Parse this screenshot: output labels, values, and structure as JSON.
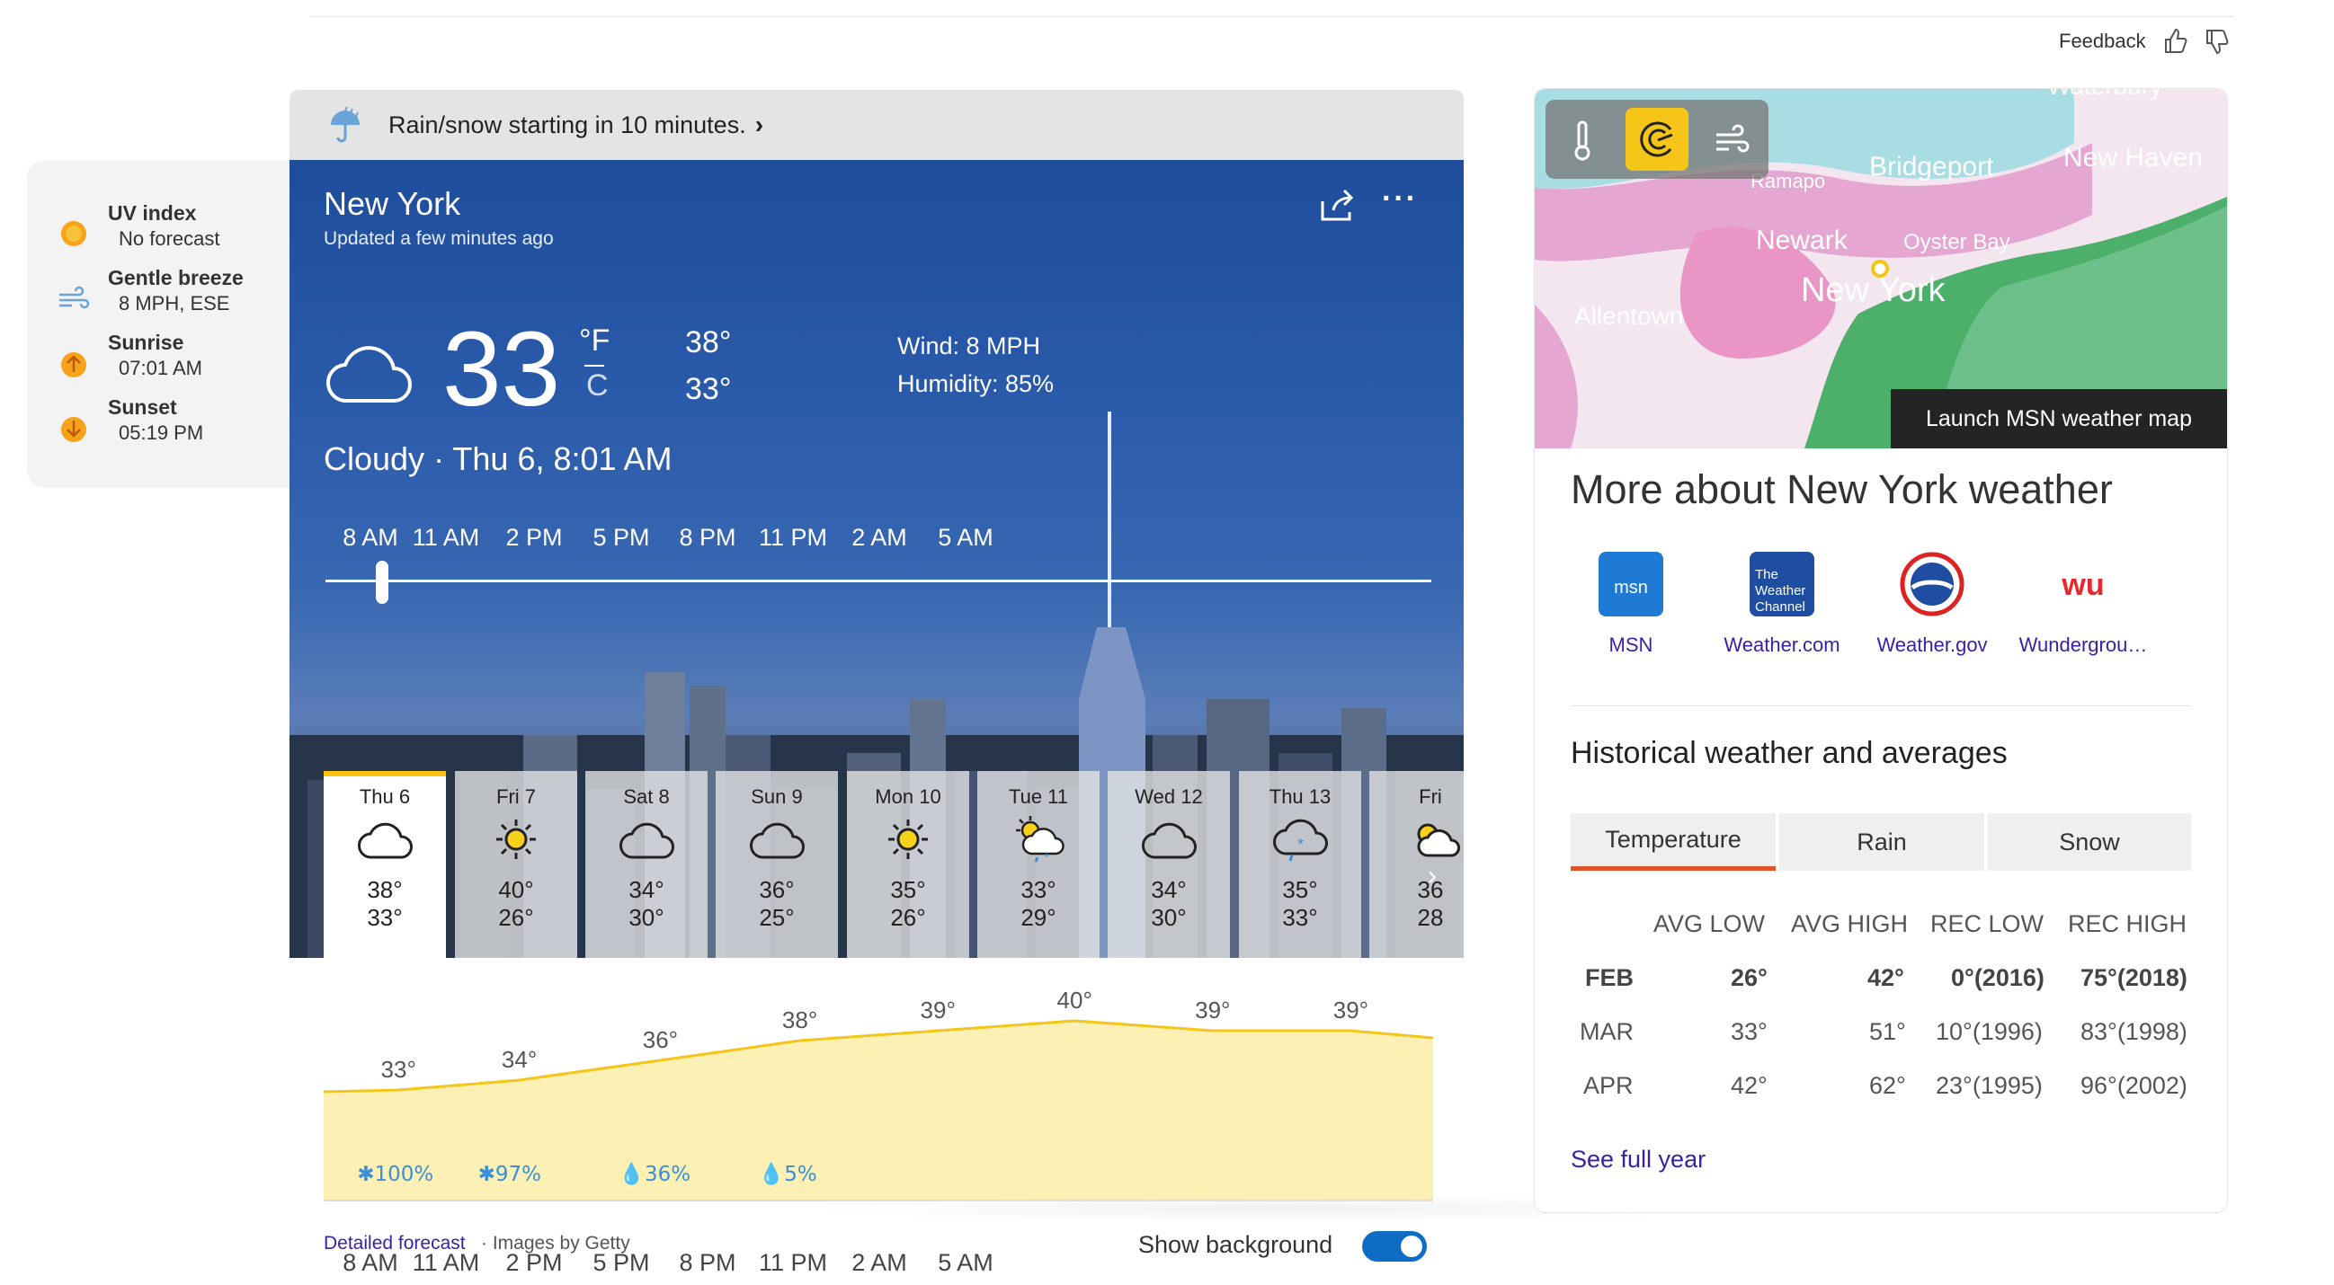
{
  "feedback": {
    "label": "Feedback"
  },
  "side": {
    "items": [
      {
        "title": "UV index",
        "value": "No forecast",
        "icon": "uv-sun-icon"
      },
      {
        "title": "Gentle breeze",
        "value": "8 MPH, ESE",
        "icon": "wind-icon"
      },
      {
        "title": "Sunrise",
        "value": "07:01 AM",
        "icon": "sunrise-icon"
      },
      {
        "title": "Sunset",
        "value": "05:19 PM",
        "icon": "sunset-icon"
      }
    ]
  },
  "alert": {
    "text": "Rain/snow starting in 10 minutes."
  },
  "current": {
    "city": "New York",
    "updated": "Updated a few minutes ago",
    "temp": "33",
    "unit_f": "°F",
    "unit_c": "C",
    "high": "38°",
    "low": "33°",
    "wind": "Wind: 8 MPH",
    "humidity": "Humidity: 85%",
    "condition": "Cloudy · Thu 6, 8:01 AM"
  },
  "hours": [
    "8 AM",
    "11 AM",
    "2 PM",
    "5 PM",
    "8 PM",
    "11 PM",
    "2 AM",
    "5 AM"
  ],
  "days": [
    {
      "name": "Thu 6",
      "hi": "38°",
      "lo": "33°",
      "icon": "cloud"
    },
    {
      "name": "Fri 7",
      "hi": "40°",
      "lo": "26°",
      "icon": "sun"
    },
    {
      "name": "Sat 8",
      "hi": "34°",
      "lo": "30°",
      "icon": "cloud"
    },
    {
      "name": "Sun 9",
      "hi": "36°",
      "lo": "25°",
      "icon": "cloud"
    },
    {
      "name": "Mon 10",
      "hi": "35°",
      "lo": "26°",
      "icon": "sun"
    },
    {
      "name": "Tue 11",
      "hi": "33°",
      "lo": "29°",
      "icon": "sun-cloud-rain-snow"
    },
    {
      "name": "Wed 12",
      "hi": "34°",
      "lo": "30°",
      "icon": "cloud"
    },
    {
      "name": "Thu 13",
      "hi": "35°",
      "lo": "33°",
      "icon": "cloud-snow"
    },
    {
      "name": "Fri",
      "hi": "36",
      "lo": "28",
      "icon": "sun-cloud"
    }
  ],
  "hourly_chart": {
    "temps": [
      33,
      34,
      36,
      38,
      39,
      40,
      39,
      39
    ],
    "temp_labels": [
      "33°",
      "34°",
      "36°",
      "38°",
      "39°",
      "40°",
      "39°",
      "39°"
    ],
    "precip": [
      {
        "label": "100%",
        "type": "snow"
      },
      {
        "label": "97%",
        "type": "snow"
      },
      {
        "label": "36%",
        "type": "rain"
      },
      {
        "label": "5%",
        "type": "rain"
      }
    ]
  },
  "footer": {
    "detailed": "Detailed forecast",
    "getty": "· Images by Getty",
    "show_background": "Show background"
  },
  "map": {
    "launch": "Launch MSN weather map",
    "places": [
      "Waterbury",
      "Bridgeport",
      "New Haven",
      "Ramapo",
      "Newark",
      "Oyster Bay",
      "New York",
      "Allentown"
    ]
  },
  "more": {
    "title": "More about New York weather",
    "sources": [
      {
        "label": "MSN",
        "logo_text": "msn"
      },
      {
        "label": "Weather.com",
        "logo_text": "The Weather Channel"
      },
      {
        "label": "Weather.gov",
        "logo_text": ""
      },
      {
        "label": "Wundergrou…",
        "logo_text": "wu"
      }
    ]
  },
  "history": {
    "title": "Historical weather and averages",
    "tabs": [
      "Temperature",
      "Rain",
      "Snow"
    ],
    "columns": [
      "AVG LOW",
      "AVG HIGH",
      "REC LOW",
      "REC HIGH"
    ],
    "rows": [
      {
        "month": "FEB",
        "avg_low": "26°",
        "avg_high": "42°",
        "rec_low": "0°(2016)",
        "rec_high": "75°(2018)"
      },
      {
        "month": "MAR",
        "avg_low": "33°",
        "avg_high": "51°",
        "rec_low": "10°(1996)",
        "rec_high": "83°(1998)"
      },
      {
        "month": "APR",
        "avg_low": "42°",
        "avg_high": "62°",
        "rec_low": "23°(1995)",
        "rec_high": "96°(2002)"
      }
    ],
    "see_full": "See full year"
  },
  "colors": {
    "accent_yellow": "#ffc20e",
    "tab_underline": "#e0532b",
    "toggle": "#0e6cc4",
    "link": "#3a1fa8"
  }
}
